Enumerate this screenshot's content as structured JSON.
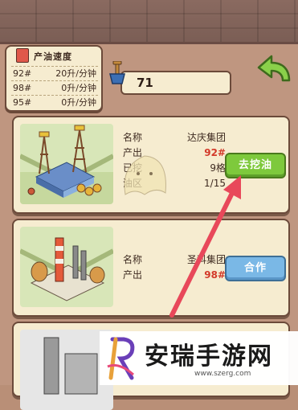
{
  "speed_panel": {
    "title": "产油速度",
    "rows": [
      {
        "id": "92#",
        "rate": "20升/分钟"
      },
      {
        "id": "98#",
        "rate": "0升/分钟"
      },
      {
        "id": "95#",
        "rate": "0升/分钟"
      }
    ]
  },
  "counter": {
    "value": "71"
  },
  "cards": [
    {
      "rows": [
        {
          "k": "名称",
          "v": "达庆集团",
          "red": false
        },
        {
          "k": "产出",
          "v": "92#",
          "red": true
        },
        {
          "k": "已挖",
          "v": "9格",
          "red": false
        },
        {
          "k": "油区",
          "v": "1/15",
          "red": false
        }
      ],
      "button": "去挖油"
    },
    {
      "rows": [
        {
          "k": "名称",
          "v": "圣科集团",
          "red": false
        },
        {
          "k": "产出",
          "v": "98#",
          "red": true
        }
      ],
      "button": "合作"
    }
  ],
  "watermark": {
    "title": "安瑞手游网",
    "url": "www.szerg.com"
  },
  "colors": {
    "accent_green": "#7ec93c",
    "accent_blue": "#7ab8e6",
    "arrow": "#e8485a"
  }
}
